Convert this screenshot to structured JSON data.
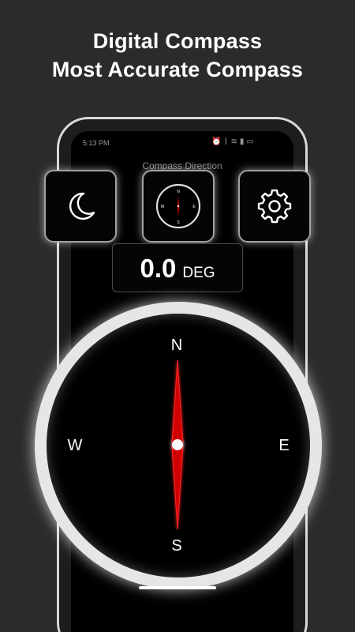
{
  "promo": {
    "line1": "Digital Compass",
    "line2": "Most Accurate Compass"
  },
  "status_bar": {
    "time": "5:13 PM",
    "icons": [
      "alarm-icon",
      "bluetooth-icon",
      "wifi-icon",
      "signal-icon",
      "battery-icon"
    ]
  },
  "screen": {
    "title": "Compass Direction"
  },
  "toolbar": {
    "night_mode_icon": "moon-icon",
    "compass_style_icon": "compass-icon",
    "mini_compass_letters": {
      "n": "N",
      "e": "E",
      "s": "S",
      "w": "W"
    },
    "settings_icon": "gear-icon"
  },
  "heading": {
    "value": "0.0",
    "unit": "DEG"
  },
  "compass": {
    "north": "N",
    "east": "E",
    "south": "S",
    "west": "W",
    "heading_degrees": 0
  },
  "colors": {
    "background": "#2b2b2b",
    "needle": "#d10000",
    "ring": "#e6e6e6"
  }
}
